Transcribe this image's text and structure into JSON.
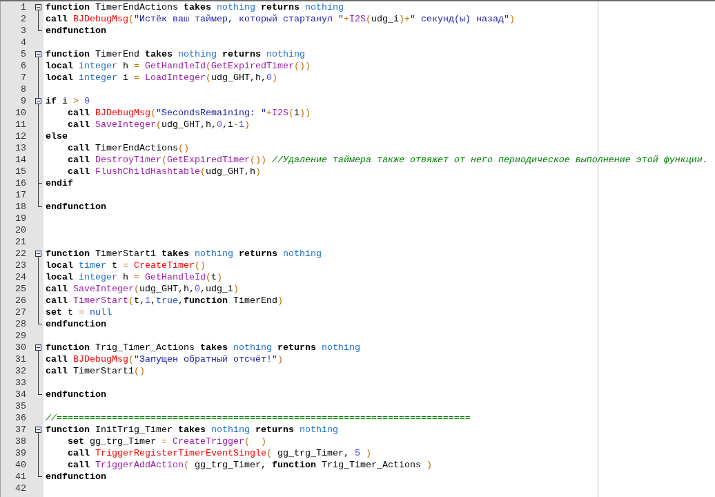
{
  "editor": {
    "lines": [
      {
        "number": "1",
        "kind": "open",
        "indented": false,
        "tokens": [
          {
            "t": "function ",
            "kind": "kw"
          },
          {
            "t": "TimerEndActions ",
            "kind": "plain"
          },
          {
            "t": "takes ",
            "kind": "kw"
          },
          {
            "t": "nothing ",
            "kind": "type"
          },
          {
            "t": "returns ",
            "kind": "kw"
          },
          {
            "t": "nothing",
            "kind": "type"
          }
        ]
      },
      {
        "number": "2",
        "kind": "line",
        "indented": false,
        "tokens": [
          {
            "t": "call ",
            "kind": "kw"
          },
          {
            "t": "BJDebugMsg",
            "kind": "red"
          },
          {
            "t": "(",
            "kind": "op"
          },
          {
            "t": "\"Истёк ваш таймер, который стартанул \"",
            "kind": "str"
          },
          {
            "t": "+",
            "kind": "op"
          },
          {
            "t": "I2S",
            "kind": "purple"
          },
          {
            "t": "(",
            "kind": "op"
          },
          {
            "t": "udg_i",
            "kind": "plain"
          },
          {
            "t": ")+",
            "kind": "op"
          },
          {
            "t": "\" секунд(ы) назад\"",
            "kind": "str"
          },
          {
            "t": ")",
            "kind": "op"
          }
        ]
      },
      {
        "number": "3",
        "kind": "end",
        "indented": false,
        "tokens": [
          {
            "t": "endfunction",
            "kind": "kw"
          }
        ]
      },
      {
        "number": "4",
        "kind": "none"
      },
      {
        "number": "5",
        "kind": "open",
        "indented": false,
        "tokens": [
          {
            "t": "function ",
            "kind": "kw"
          },
          {
            "t": "TimerEnd ",
            "kind": "plain"
          },
          {
            "t": "takes ",
            "kind": "kw"
          },
          {
            "t": "nothing ",
            "kind": "type"
          },
          {
            "t": "returns ",
            "kind": "kw"
          },
          {
            "t": "nothing",
            "kind": "type"
          }
        ]
      },
      {
        "number": "6",
        "kind": "line",
        "indented": false,
        "tokens": [
          {
            "t": "local ",
            "kind": "kw"
          },
          {
            "t": "integer ",
            "kind": "type"
          },
          {
            "t": "h ",
            "kind": "plain"
          },
          {
            "t": "= ",
            "kind": "op"
          },
          {
            "t": "GetHandleId",
            "kind": "purple"
          },
          {
            "t": "(",
            "kind": "op"
          },
          {
            "t": "GetExpiredTimer",
            "kind": "purple"
          },
          {
            "t": "())",
            "kind": "op"
          }
        ]
      },
      {
        "number": "7",
        "kind": "line",
        "indented": false,
        "tokens": [
          {
            "t": "local ",
            "kind": "kw"
          },
          {
            "t": "integer ",
            "kind": "type"
          },
          {
            "t": "i ",
            "kind": "plain"
          },
          {
            "t": "= ",
            "kind": "op"
          },
          {
            "t": "LoadInteger",
            "kind": "purple"
          },
          {
            "t": "(",
            "kind": "op"
          },
          {
            "t": "udg_GHT,h,",
            "kind": "plain"
          },
          {
            "t": "0",
            "kind": "num"
          },
          {
            "t": ")",
            "kind": "op"
          }
        ]
      },
      {
        "number": "8",
        "kind": "line"
      },
      {
        "number": "9",
        "kind": "open_inner",
        "indented": false,
        "tokens": [
          {
            "t": "if ",
            "kind": "kw"
          },
          {
            "t": "i ",
            "kind": "plain"
          },
          {
            "t": "> ",
            "kind": "op"
          },
          {
            "t": "0",
            "kind": "num"
          }
        ]
      },
      {
        "number": "10",
        "kind": "line",
        "indented": true,
        "tokens": [
          {
            "t": "call ",
            "kind": "kw"
          },
          {
            "t": "BJDebugMsg",
            "kind": "red"
          },
          {
            "t": "(",
            "kind": "op"
          },
          {
            "t": "\"SecondsRemaining: \"",
            "kind": "str"
          },
          {
            "t": "+",
            "kind": "op"
          },
          {
            "t": "I2S",
            "kind": "purple"
          },
          {
            "t": "(",
            "kind": "op"
          },
          {
            "t": "i",
            "kind": "plain"
          },
          {
            "t": "))",
            "kind": "op"
          }
        ]
      },
      {
        "number": "11",
        "kind": "line",
        "indented": true,
        "tokens": [
          {
            "t": "call ",
            "kind": "kw"
          },
          {
            "t": "SaveInteger",
            "kind": "purple"
          },
          {
            "t": "(",
            "kind": "op"
          },
          {
            "t": "udg_GHT,h,",
            "kind": "plain"
          },
          {
            "t": "0",
            "kind": "num"
          },
          {
            "t": ",i",
            "kind": "plain"
          },
          {
            "t": "-",
            "kind": "op"
          },
          {
            "t": "1",
            "kind": "num"
          },
          {
            "t": ")",
            "kind": "op"
          }
        ]
      },
      {
        "number": "12",
        "kind": "line",
        "indented": false,
        "tokens": [
          {
            "t": "else",
            "kind": "kw"
          }
        ]
      },
      {
        "number": "13",
        "kind": "line",
        "indented": true,
        "tokens": [
          {
            "t": "call ",
            "kind": "kw"
          },
          {
            "t": "TimerEndActions",
            "kind": "plain"
          },
          {
            "t": "()",
            "kind": "op"
          }
        ]
      },
      {
        "number": "14",
        "kind": "line",
        "indented": true,
        "tokens": [
          {
            "t": "call ",
            "kind": "kw"
          },
          {
            "t": "DestroyTimer",
            "kind": "purple"
          },
          {
            "t": "(",
            "kind": "op"
          },
          {
            "t": "GetExpiredTimer",
            "kind": "purple"
          },
          {
            "t": "()) ",
            "kind": "op"
          },
          {
            "t": "//Удаление таймера также отвяжет от него периодическое выполнение этой функции.",
            "kind": "cmt"
          }
        ]
      },
      {
        "number": "15",
        "kind": "line",
        "indented": true,
        "tokens": [
          {
            "t": "call ",
            "kind": "kw"
          },
          {
            "t": "FlushChildHashtable",
            "kind": "purple"
          },
          {
            "t": "(",
            "kind": "op"
          },
          {
            "t": "udg_GHT,h",
            "kind": "plain"
          },
          {
            "t": ")",
            "kind": "op"
          }
        ]
      },
      {
        "number": "16",
        "kind": "branch",
        "indented": false,
        "tokens": [
          {
            "t": "endif",
            "kind": "kw"
          }
        ]
      },
      {
        "number": "17",
        "kind": "line"
      },
      {
        "number": "18",
        "kind": "end",
        "indented": false,
        "tokens": [
          {
            "t": "endfunction",
            "kind": "kw"
          }
        ]
      },
      {
        "number": "19",
        "kind": "none"
      },
      {
        "number": "20",
        "kind": "none"
      },
      {
        "number": "21",
        "kind": "none"
      },
      {
        "number": "22",
        "kind": "open",
        "indented": false,
        "tokens": [
          {
            "t": "function ",
            "kind": "kw"
          },
          {
            "t": "TimerStart1 ",
            "kind": "plain"
          },
          {
            "t": "takes ",
            "kind": "kw"
          },
          {
            "t": "nothing ",
            "kind": "type"
          },
          {
            "t": "returns ",
            "kind": "kw"
          },
          {
            "t": "nothing",
            "kind": "type"
          }
        ]
      },
      {
        "number": "23",
        "kind": "line",
        "indented": false,
        "tokens": [
          {
            "t": "local ",
            "kind": "kw"
          },
          {
            "t": "timer ",
            "kind": "type"
          },
          {
            "t": "t ",
            "kind": "plain"
          },
          {
            "t": "= ",
            "kind": "op"
          },
          {
            "t": "CreateTimer",
            "kind": "red"
          },
          {
            "t": "()",
            "kind": "op"
          }
        ]
      },
      {
        "number": "24",
        "kind": "line",
        "indented": false,
        "tokens": [
          {
            "t": "local ",
            "kind": "kw"
          },
          {
            "t": "integer ",
            "kind": "type"
          },
          {
            "t": "h ",
            "kind": "plain"
          },
          {
            "t": "= ",
            "kind": "op"
          },
          {
            "t": "GetHandleId",
            "kind": "purple"
          },
          {
            "t": "(",
            "kind": "op"
          },
          {
            "t": "t",
            "kind": "plain"
          },
          {
            "t": ")",
            "kind": "op"
          }
        ]
      },
      {
        "number": "25",
        "kind": "line",
        "indented": false,
        "tokens": [
          {
            "t": "call ",
            "kind": "kw"
          },
          {
            "t": "SaveInteger",
            "kind": "purple"
          },
          {
            "t": "(",
            "kind": "op"
          },
          {
            "t": "udg_GHT,h,",
            "kind": "plain"
          },
          {
            "t": "0",
            "kind": "num"
          },
          {
            "t": ",udg_i",
            "kind": "plain"
          },
          {
            "t": ")",
            "kind": "op"
          }
        ]
      },
      {
        "number": "26",
        "kind": "line",
        "indented": false,
        "tokens": [
          {
            "t": "call ",
            "kind": "kw"
          },
          {
            "t": "TimerStart",
            "kind": "purple"
          },
          {
            "t": "(",
            "kind": "op"
          },
          {
            "t": "t,",
            "kind": "plain"
          },
          {
            "t": "1",
            "kind": "num"
          },
          {
            "t": ",",
            "kind": "plain"
          },
          {
            "t": "true",
            "kind": "lit"
          },
          {
            "t": ",",
            "kind": "plain"
          },
          {
            "t": "function ",
            "kind": "kw"
          },
          {
            "t": "TimerEnd",
            "kind": "plain"
          },
          {
            "t": ")",
            "kind": "op"
          }
        ]
      },
      {
        "number": "27",
        "kind": "line",
        "indented": false,
        "tokens": [
          {
            "t": "set ",
            "kind": "kw"
          },
          {
            "t": "t ",
            "kind": "plain"
          },
          {
            "t": "= ",
            "kind": "op"
          },
          {
            "t": "null",
            "kind": "lit"
          }
        ]
      },
      {
        "number": "28",
        "kind": "end",
        "indented": false,
        "tokens": [
          {
            "t": "endfunction",
            "kind": "kw"
          }
        ]
      },
      {
        "number": "29",
        "kind": "none"
      },
      {
        "number": "30",
        "kind": "open",
        "indented": false,
        "tokens": [
          {
            "t": "function ",
            "kind": "kw"
          },
          {
            "t": "Trig_Timer_Actions ",
            "kind": "plain"
          },
          {
            "t": "takes ",
            "kind": "kw"
          },
          {
            "t": "nothing ",
            "kind": "type"
          },
          {
            "t": "returns ",
            "kind": "kw"
          },
          {
            "t": "nothing",
            "kind": "type"
          }
        ]
      },
      {
        "number": "31",
        "kind": "line",
        "indented": false,
        "tokens": [
          {
            "t": "call ",
            "kind": "kw"
          },
          {
            "t": "BJDebugMsg",
            "kind": "red"
          },
          {
            "t": "(",
            "kind": "op"
          },
          {
            "t": "\"Запущен обратный отсчёт!\"",
            "kind": "str"
          },
          {
            "t": ")",
            "kind": "op"
          }
        ]
      },
      {
        "number": "32",
        "kind": "line",
        "indented": false,
        "tokens": [
          {
            "t": "call ",
            "kind": "kw"
          },
          {
            "t": "TimerStart1",
            "kind": "plain"
          },
          {
            "t": "()",
            "kind": "op"
          }
        ]
      },
      {
        "number": "33",
        "kind": "line"
      },
      {
        "number": "34",
        "kind": "end",
        "indented": false,
        "tokens": [
          {
            "t": "endfunction",
            "kind": "kw"
          }
        ]
      },
      {
        "number": "35",
        "kind": "none"
      },
      {
        "number": "36",
        "kind": "none",
        "indented": false,
        "tokens": [
          {
            "t": "//===========================================================================",
            "kind": "cmt"
          }
        ]
      },
      {
        "number": "37",
        "kind": "open",
        "indented": false,
        "tokens": [
          {
            "t": "function ",
            "kind": "kw"
          },
          {
            "t": "InitTrig_Timer ",
            "kind": "plain"
          },
          {
            "t": "takes ",
            "kind": "kw"
          },
          {
            "t": "nothing ",
            "kind": "type"
          },
          {
            "t": "returns ",
            "kind": "kw"
          },
          {
            "t": "nothing",
            "kind": "type"
          }
        ]
      },
      {
        "number": "38",
        "kind": "line",
        "indented": true,
        "tokens": [
          {
            "t": "set ",
            "kind": "kw"
          },
          {
            "t": "gg_trg_Timer ",
            "kind": "plain"
          },
          {
            "t": "= ",
            "kind": "op"
          },
          {
            "t": "CreateTrigger",
            "kind": "purple"
          },
          {
            "t": "(  )",
            "kind": "op"
          }
        ]
      },
      {
        "number": "39",
        "kind": "line",
        "indented": true,
        "tokens": [
          {
            "t": "call ",
            "kind": "kw"
          },
          {
            "t": "TriggerRegisterTimerEventSingle",
            "kind": "red"
          },
          {
            "t": "( ",
            "kind": "op"
          },
          {
            "t": "gg_trg_Timer, ",
            "kind": "plain"
          },
          {
            "t": "5",
            "kind": "num"
          },
          {
            "t": " )",
            "kind": "op"
          }
        ]
      },
      {
        "number": "40",
        "kind": "line",
        "indented": true,
        "tokens": [
          {
            "t": "call ",
            "kind": "kw"
          },
          {
            "t": "TriggerAddAction",
            "kind": "purple"
          },
          {
            "t": "( ",
            "kind": "op"
          },
          {
            "t": "gg_trg_Timer, ",
            "kind": "plain"
          },
          {
            "t": "function ",
            "kind": "kw"
          },
          {
            "t": "Trig_Timer_Actions ",
            "kind": "plain"
          },
          {
            "t": ")",
            "kind": "op"
          }
        ]
      },
      {
        "number": "41",
        "kind": "end",
        "indented": false,
        "tokens": [
          {
            "t": "endfunction",
            "kind": "kw"
          }
        ]
      },
      {
        "number": "42",
        "kind": "none"
      }
    ]
  }
}
